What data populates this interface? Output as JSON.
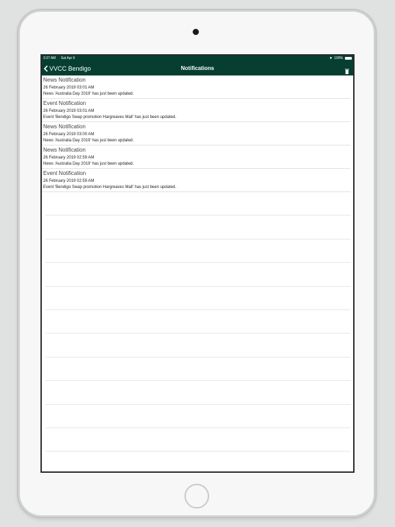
{
  "status_bar": {
    "time": "3:37 AM",
    "date": "Sat Apr 6",
    "battery": "100%"
  },
  "nav": {
    "back_label": "VVCC Bendigo",
    "title": "Notifications",
    "back_icon": "chevron-left-icon",
    "trash_icon": "trash-icon"
  },
  "notifications": [
    {
      "title": "News Notification",
      "date": "26 February 2019 03:01 AM",
      "message": "News 'Australia Day 2019' has just been updated."
    },
    {
      "title": "Event Notification",
      "date": "26 February 2019 03:01 AM",
      "message": "Event 'Bendigo Swap promotion Hargreaves Mall' has just been updated."
    },
    {
      "title": "News Notification",
      "date": "26 February 2019 03:00 AM",
      "message": "News 'Australia Day 2019' has just been updated."
    },
    {
      "title": "News Notification",
      "date": "26 February 2019 02:59 AM",
      "message": "News 'Australia Day 2019' has just been updated."
    },
    {
      "title": "Event Notification",
      "date": "26 February 2019 02:59 AM",
      "message": "Event 'Bendigo Swap promotion Hargreaves Mall' has just been updated."
    }
  ],
  "colors": {
    "brand": "#063f32",
    "background": "#dfe2e1"
  }
}
